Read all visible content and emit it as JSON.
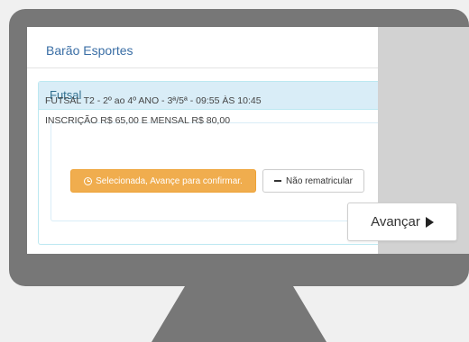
{
  "app": {
    "title": "Barão Esportes"
  },
  "panel": {
    "title": "Futsal"
  },
  "option": {
    "line1": "FUTSAL T2 - 2º ao 4º ANO - 3ª/5ª - 09:55 ÀS 10:45",
    "line2": "INSCRIÇÃO R$ 65,00 E MENSAL R$ 80,00",
    "selected_label": "Selecionada, Avançe para confirmar.",
    "unenroll_label": "Não rematricular"
  },
  "advance_label": "Avançar",
  "icons": {
    "selected": "clock-icon",
    "unenroll": "minus-icon",
    "advance": "play-icon"
  },
  "colors": {
    "monitor": "#777777",
    "accent_orange": "#f0ad4e",
    "panel_heading": "#d9edf7",
    "title_blue": "#3a6ea5"
  }
}
